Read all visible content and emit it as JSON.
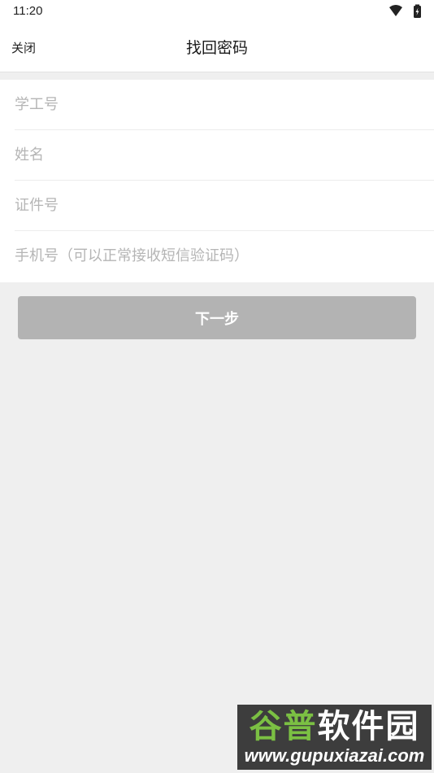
{
  "status_bar": {
    "time": "11:20",
    "icons": [
      "wifi-icon",
      "battery-charging-icon"
    ]
  },
  "nav": {
    "close_label": "关闭",
    "title": "找回密码"
  },
  "form": {
    "student_id_placeholder": "学工号",
    "name_placeholder": "姓名",
    "id_number_placeholder": "证件号",
    "phone_placeholder": "手机号（可以正常接收短信验证码）"
  },
  "actions": {
    "next_label": "下一步"
  },
  "watermark": {
    "brand_part1": "谷普",
    "brand_part2": "软件园",
    "url": "www.gupuxiazai.com"
  },
  "colors": {
    "background": "#efefef",
    "button_disabled": "#b3b3b3",
    "placeholder": "#b5b5b5"
  }
}
